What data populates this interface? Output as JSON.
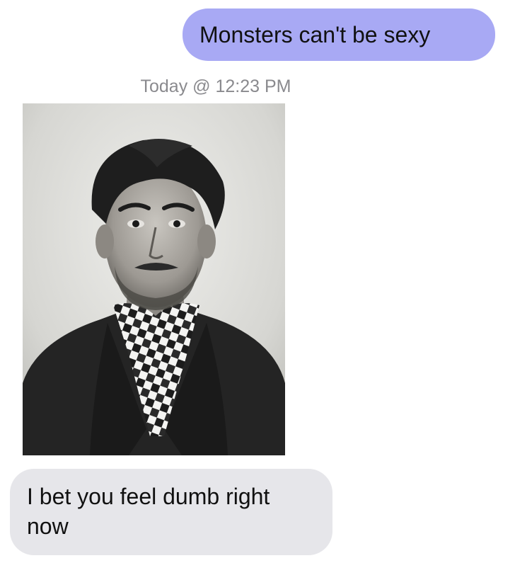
{
  "messages": {
    "outgoing_text": "Monsters can't be sexy",
    "timestamp": "Today @ 12:23 PM",
    "incoming_text": "I bet you feel dumb right now"
  },
  "colors": {
    "outgoing_bubble": "#a8a9f4",
    "incoming_bubble": "#e6e6ea",
    "timestamp_text": "#8a8a8e"
  }
}
